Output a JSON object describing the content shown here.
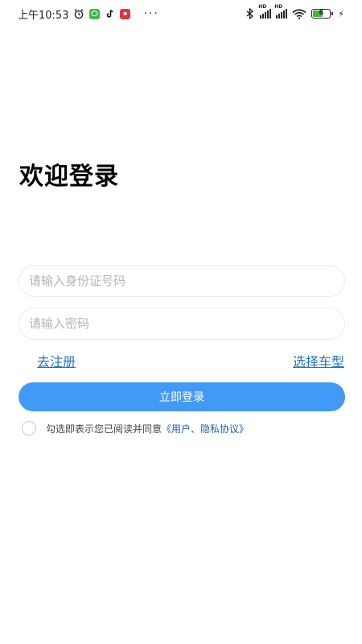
{
  "status_bar": {
    "time": "上午10:53",
    "more": "···",
    "battery_level": "6",
    "icons": [
      "alarm-icon",
      "wechat-app-icon",
      "tiktok-app-icon",
      "red-app-icon",
      "bluetooth-icon",
      "signal-hd-icon",
      "signal-hd-icon",
      "wifi-icon",
      "battery-icon",
      "charging-icon"
    ],
    "colors": {
      "wechat": "#3cb94a",
      "tiktok": "#111111",
      "red_app": "#e2353a",
      "battery_fill": "#46b544"
    }
  },
  "login": {
    "title": "欢迎登录",
    "id_placeholder": "请输入身份证号码",
    "password_placeholder": "请输入密码",
    "register_link": "去注册",
    "car_model_link": "选择车型",
    "submit_label": "立即登录",
    "agreement_text": "勾选即表示您已阅读并同意",
    "agreement_link": "《用户、隐私协议》"
  },
  "colors": {
    "accent": "#4399f6",
    "link": "#1e73c9",
    "title": "#000000"
  }
}
